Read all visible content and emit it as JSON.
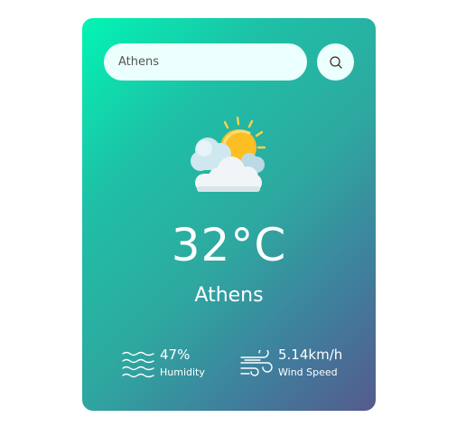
{
  "search": {
    "value": "Athens",
    "button_icon": "search-icon"
  },
  "weather": {
    "icon": "sun-behind-clouds-icon",
    "temperature": "32°C",
    "city": "Athens"
  },
  "stats": {
    "humidity": {
      "icon": "humidity-waves-icon",
      "value": "47%",
      "label": "Humidity"
    },
    "wind": {
      "icon": "wind-icon",
      "value": "5.14km/h",
      "label": "Wind Speed"
    }
  },
  "colors": {
    "gradient_start": "#02f5b4",
    "gradient_end": "#555a8d",
    "input_bg": "#ebfffc",
    "sun": "#fbbf24"
  }
}
